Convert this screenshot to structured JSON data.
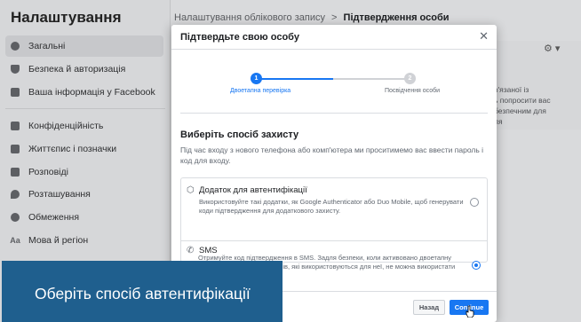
{
  "sidebar": {
    "title": "Налаштування",
    "items": [
      {
        "label": "Загальні",
        "icon": "gear-icon"
      },
      {
        "label": "Безпека й авторизація",
        "icon": "shield-icon"
      },
      {
        "label": "Ваша інформація у Facebook",
        "icon": "info-grid-icon"
      },
      {
        "label": "Конфіденційність",
        "icon": "lock-icon"
      },
      {
        "label": "Життєпис і позначки",
        "icon": "profile-tag-icon"
      },
      {
        "label": "Розповіді",
        "icon": "book-icon"
      },
      {
        "label": "Розташування",
        "icon": "location-pin-icon"
      },
      {
        "label": "Обмеження",
        "icon": "block-user-icon"
      },
      {
        "label": "Мова й регіон",
        "icon": "language-icon"
      }
    ]
  },
  "main": {
    "breadcrumb_parent": "Налаштування облікового запису",
    "breadcrumb_sep": ">",
    "breadcrumb_current": "Підтвердження особи",
    "panel_text": [
      "в'язаної із",
      "ь попросити вас",
      "безпечним для",
      "ля"
    ]
  },
  "modal": {
    "title": "Підтвердьте свою особу",
    "steps": [
      {
        "number": "1",
        "label": "Двоетапна перевірка"
      },
      {
        "number": "2",
        "label": "Посвідчення особи"
      }
    ],
    "section_title": "Виберіть спосіб захисту",
    "section_desc": "Під час входу з нового телефона або комп'ютера ми проситимемо вас ввести пароль і код для входу.",
    "options": [
      {
        "title": "Додаток для автентифікації",
        "desc": "Використовуйте такі додатки, як Google Authenticator або Duo Mobile, щоб генерувати коди підтвердження для додаткового захисту.",
        "selected": false
      },
      {
        "title": "SMS",
        "desc": "Отримуйте код підтвердження в SMS. Задля безпеки, коли активовано двоетапну перевірку, номери телефонів, які використовуються для неї, не можна використати для скидання пароля.",
        "selected": true
      }
    ],
    "back_label": "Назад",
    "continue_label": "Continue"
  },
  "banner": {
    "text": "Оберіть спосіб автентифікації"
  },
  "colors": {
    "accent": "#1877f2",
    "banner": "#1f5f8e"
  }
}
